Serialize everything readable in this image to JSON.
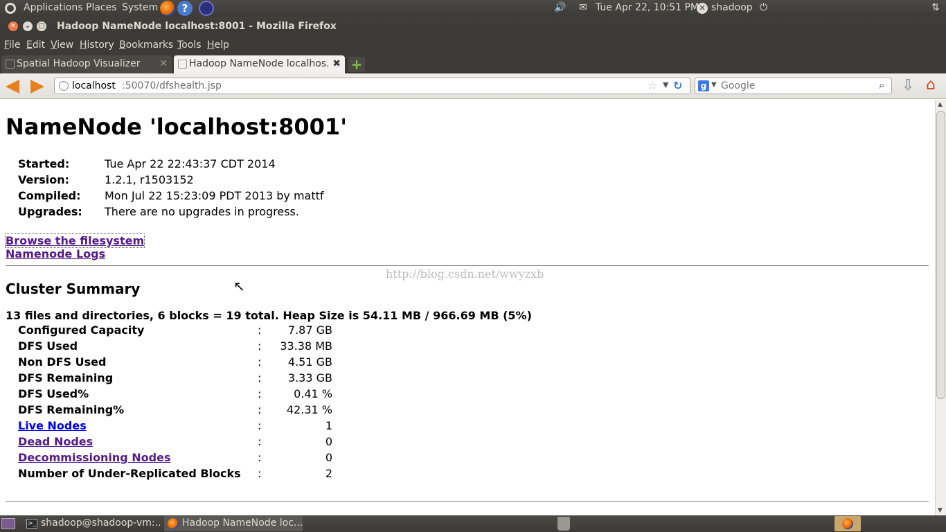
{
  "panel": {
    "applications": "Applications",
    "places": "Places",
    "system": "System",
    "datetime": "Tue Apr 22, 10:51 PM",
    "user": "shadoop"
  },
  "window": {
    "title": "Hadoop NameNode localhost:8001 - Mozilla Firefox"
  },
  "menubar": {
    "items": [
      "File",
      "Edit",
      "View",
      "History",
      "Bookmarks",
      "Tools",
      "Help"
    ]
  },
  "tabs": [
    {
      "label": "Spatial Hadoop Visualizer"
    },
    {
      "label": "Hadoop NameNode localhos..."
    }
  ],
  "nav": {
    "url_host": "localhost",
    "url_rest": ":50070/dfshealth.jsp",
    "search_placeholder": "Google"
  },
  "page": {
    "title": "NameNode 'localhost:8001'",
    "info": [
      {
        "label": "Started:",
        "value": "Tue Apr 22 22:43:37 CDT 2014"
      },
      {
        "label": "Version:",
        "value": "1.2.1, r1503152"
      },
      {
        "label": "Compiled:",
        "value": "Mon Jul 22 15:23:09 PDT 2013 by mattf"
      },
      {
        "label": "Upgrades:",
        "value": "There are no upgrades in progress."
      }
    ],
    "links": {
      "browse": "Browse the filesystem",
      "logs": "Namenode Logs"
    },
    "watermark": "http://blog.csdn.net/wwyzxb",
    "cluster_summary_title": "Cluster Summary",
    "summary_line": "13 files and directories, 6 blocks = 19 total. Heap Size is 54.11 MB / 966.69 MB (5%)",
    "separator": ":",
    "summary": [
      {
        "label": "Configured Capacity",
        "value": "7.87 GB"
      },
      {
        "label": "DFS Used",
        "value": "33.38 MB"
      },
      {
        "label": "Non DFS Used",
        "value": "4.51 GB"
      },
      {
        "label": "DFS Remaining",
        "value": "3.33 GB"
      },
      {
        "label": "DFS Used%",
        "value": "0.41 %"
      },
      {
        "label": "DFS Remaining%",
        "value": "42.31 %"
      },
      {
        "label": "Live Nodes",
        "value": "1"
      },
      {
        "label": "Dead Nodes",
        "value": "0"
      },
      {
        "label": "Decommissioning Nodes",
        "value": "0"
      },
      {
        "label": "Number of Under-Replicated Blocks",
        "value": "2"
      }
    ]
  },
  "taskbar": {
    "tasks": [
      {
        "label": "shadoop@shadoop-vm:..."
      },
      {
        "label": "Hadoop NameNode loc..."
      }
    ]
  },
  "colors": {
    "panel_bg": "#3c3b37",
    "link_visited": "#551a8b",
    "link_unvisited": "#0000ee",
    "tab_active_bg": "#f2f1f0"
  }
}
